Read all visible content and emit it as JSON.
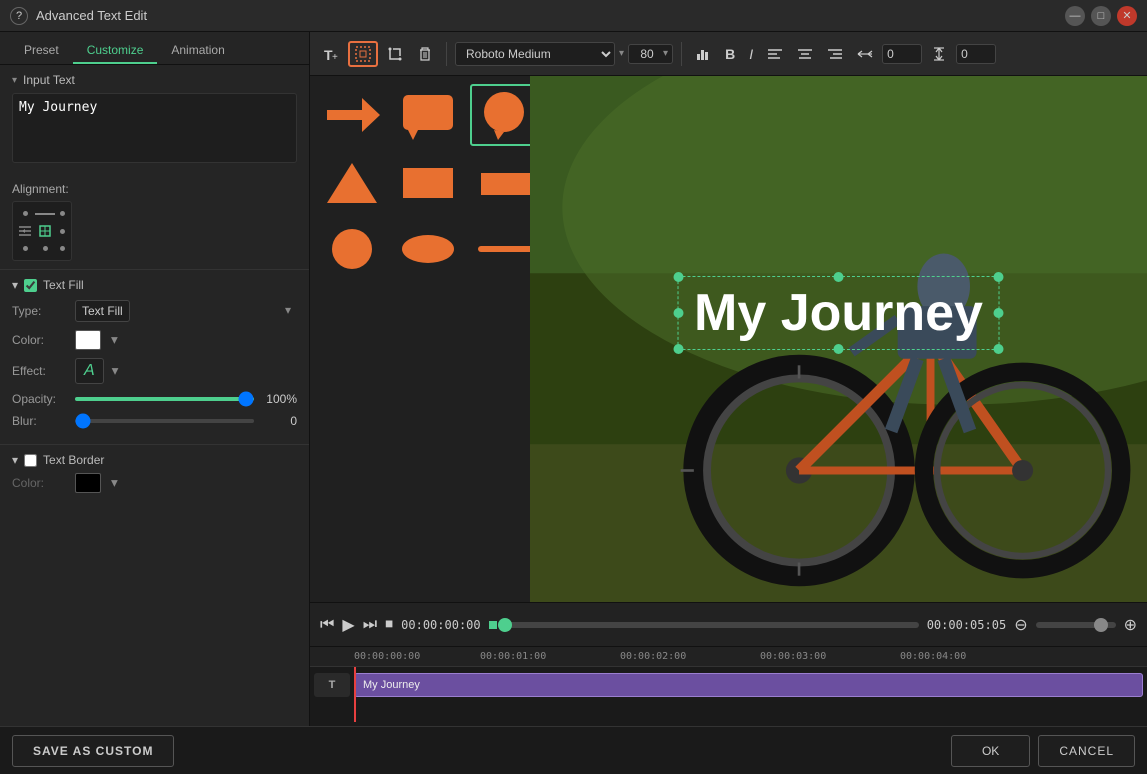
{
  "titleBar": {
    "title": "Advanced Text Edit",
    "helpBtn": "?",
    "minimizeBtn": "—",
    "maximizeBtn": "□",
    "closeBtn": "✕"
  },
  "tabs": {
    "items": [
      "Preset",
      "Customize",
      "Animation"
    ],
    "activeIndex": 1
  },
  "inputText": {
    "sectionLabel": "Input Text",
    "value": "My Journey",
    "alignmentLabel": "Alignment:"
  },
  "textFill": {
    "sectionLabel": "Text Fill",
    "checked": true,
    "typeLabel": "Type:",
    "typeValue": "Text Fill",
    "colorLabel": "Color:",
    "effectLabel": "Effect:",
    "effectSymbol": "A",
    "opacityLabel": "Opacity:",
    "opacityValue": "100%",
    "blurLabel": "Blur:",
    "blurValue": "0"
  },
  "textBorder": {
    "sectionLabel": "Text Border",
    "checked": false,
    "colorLabel": "Color:"
  },
  "toolbar": {
    "fontName": "Roboto Medium",
    "fontSize": "80",
    "fontDropdown": "▾",
    "boldLabel": "B",
    "italicLabel": "I",
    "alignLeft": "≡",
    "alignCenter": "≡",
    "alignRight": "≡",
    "spacingLabel": "spacing",
    "spacingValue": "0",
    "lineHeightValue": "0",
    "deleteLabel": "🗑"
  },
  "canvas": {
    "textOverlay": "My Journey",
    "textColor": "#ffffff",
    "textFont": "Roboto Medium"
  },
  "playbar": {
    "currentTime": "00:00:00:00",
    "totalTime": "00:00:05:05",
    "zoomMinus": "⊖",
    "zoomPlus": "⊕"
  },
  "timeline": {
    "ticks": [
      "00:00:00:00",
      "00:00:01:00",
      "00:00:02:00",
      "00:00:03:00",
      "00:00:04:00"
    ],
    "trackLabel": "T",
    "clipLabel": "My Journey"
  },
  "bottomBar": {
    "saveAsCustom": "SAVE AS CUSTOM",
    "okLabel": "OK",
    "cancelLabel": "CANCEL"
  },
  "shapes": [
    {
      "type": "arrow",
      "color": "#e87030"
    },
    {
      "type": "speech-bubble",
      "color": "#e87030"
    },
    {
      "type": "circle-bubble",
      "color": "#e87030",
      "selected": true
    },
    {
      "type": "triangle",
      "color": "#e87030"
    },
    {
      "type": "rectangle",
      "color": "#e87030"
    },
    {
      "type": "small-rect",
      "color": "#e87030"
    },
    {
      "type": "circle",
      "color": "#e87030"
    },
    {
      "type": "oval",
      "color": "#e87030"
    },
    {
      "type": "line",
      "color": "#e87030"
    }
  ]
}
